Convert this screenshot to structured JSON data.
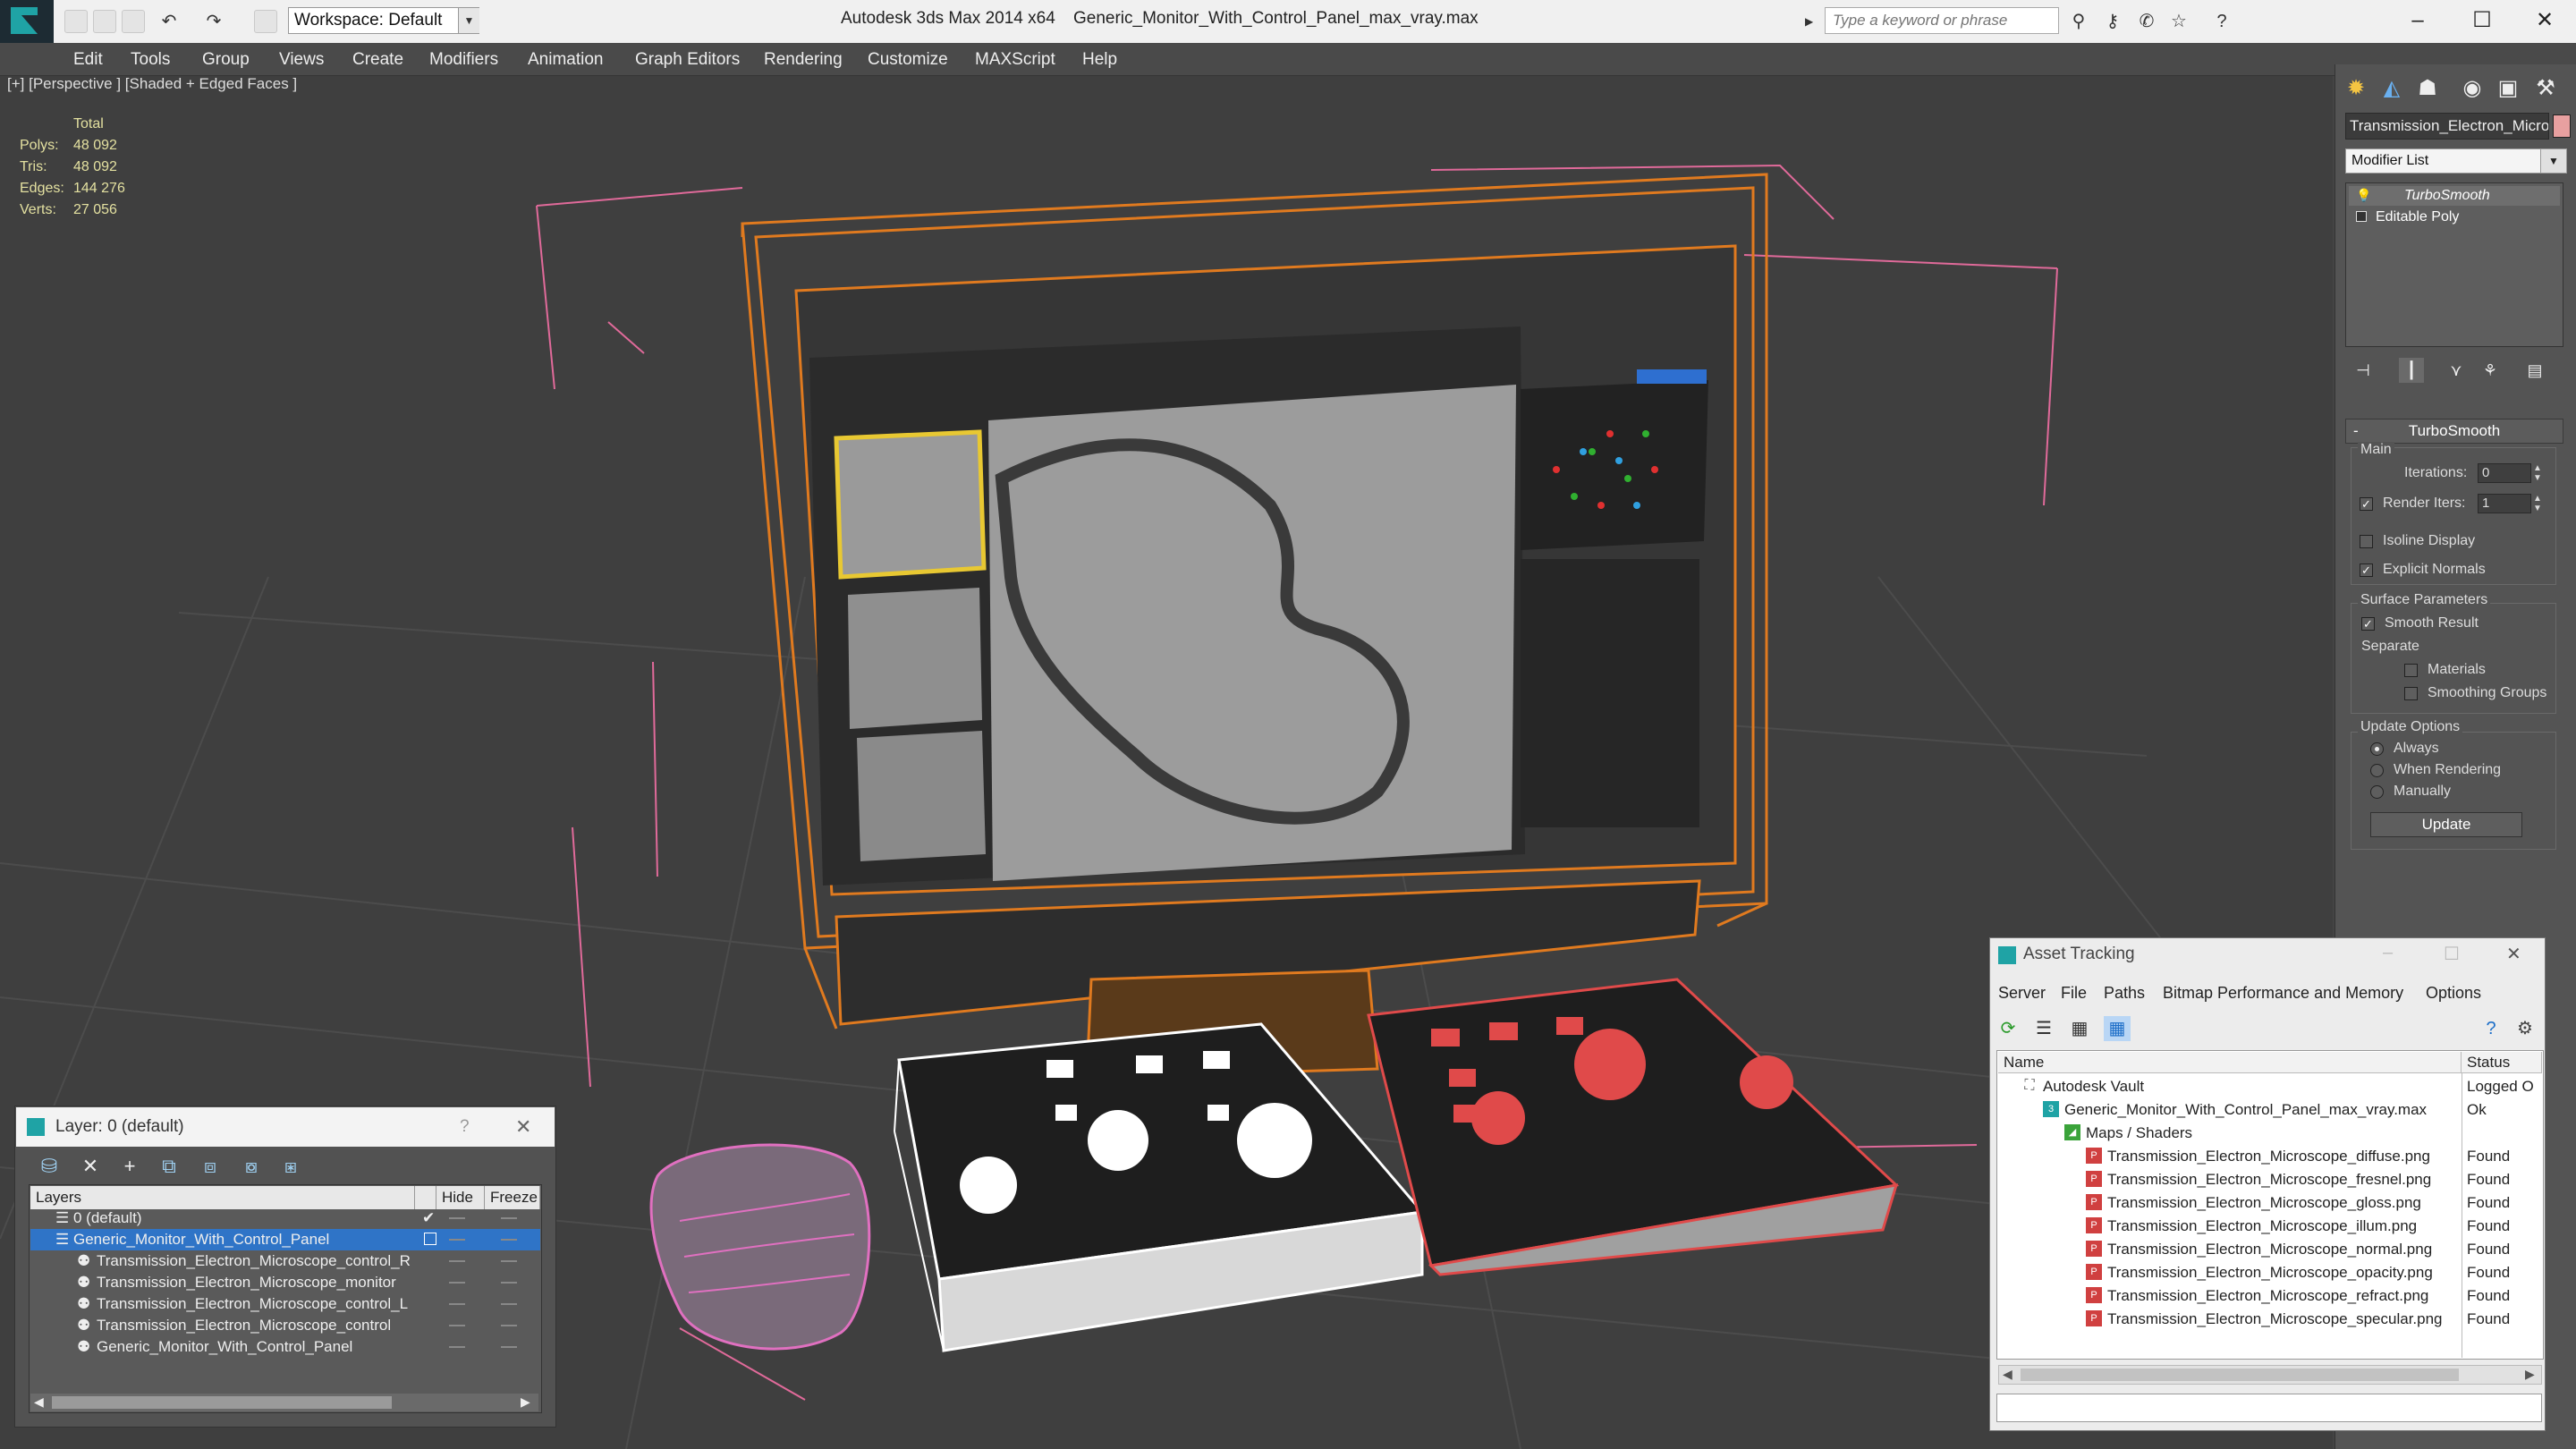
{
  "titlebar": {
    "workspace": "Workspace: Default",
    "app_title": "Autodesk 3ds Max  2014 x64",
    "file_title": "Generic_Monitor_With_Control_Panel_max_vray.max",
    "search_placeholder": "Type a keyword or phrase"
  },
  "menu": [
    "Edit",
    "Tools",
    "Group",
    "Views",
    "Create",
    "Modifiers",
    "Animation",
    "Graph Editors",
    "Rendering",
    "Customize",
    "MAXScript",
    "Help"
  ],
  "viewport": {
    "label": "[+] [Perspective ] [Shaded + Edged Faces ]",
    "stats": {
      "header": "Total",
      "rows": [
        {
          "label": "Polys:",
          "value": "48 092"
        },
        {
          "label": "Tris:",
          "value": "48 092"
        },
        {
          "label": "Edges:",
          "value": "144 276"
        },
        {
          "label": "Verts:",
          "value": "27 056"
        }
      ]
    }
  },
  "command_panel": {
    "object_name": "Transmission_Electron_Micros",
    "modifier_list": "Modifier List",
    "stack": [
      "TurboSmooth",
      "Editable Poly"
    ],
    "turbosmooth": {
      "title": "TurboSmooth",
      "main": "Main",
      "iterations_label": "Iterations:",
      "iterations_value": "0",
      "render_iters_label": "Render Iters:",
      "render_iters_value": "1",
      "isoline": "Isoline Display",
      "explicit_normals": "Explicit Normals",
      "surface_params": "Surface Parameters",
      "smooth_result": "Smooth Result",
      "separate": "Separate",
      "materials": "Materials",
      "smoothing_groups": "Smoothing Groups",
      "update_options": "Update Options",
      "always": "Always",
      "when_rendering": "When Rendering",
      "manually": "Manually",
      "update_btn": "Update"
    }
  },
  "layer_dialog": {
    "title": "Layer: 0 (default)",
    "help": "?",
    "headers": [
      "Layers",
      "Hide",
      "Freeze"
    ],
    "rows": [
      {
        "name": "0 (default)",
        "indent": 0,
        "selected": false
      },
      {
        "name": "Generic_Monitor_With_Control_Panel",
        "indent": 0,
        "selected": true
      },
      {
        "name": "Transmission_Electron_Microscope_control_R",
        "indent": 1,
        "selected": false
      },
      {
        "name": "Transmission_Electron_Microscope_monitor",
        "indent": 1,
        "selected": false
      },
      {
        "name": "Transmission_Electron_Microscope_control_L",
        "indent": 1,
        "selected": false
      },
      {
        "name": "Transmission_Electron_Microscope_control",
        "indent": 1,
        "selected": false
      },
      {
        "name": "Generic_Monitor_With_Control_Panel",
        "indent": 1,
        "selected": false
      }
    ]
  },
  "asset_tracking": {
    "title": "Asset Tracking",
    "menu": [
      "Server",
      "File",
      "Paths",
      "Bitmap Performance and Memory",
      "Options"
    ],
    "headers": [
      "Name",
      "Status"
    ],
    "rows": [
      {
        "name": "Autodesk Vault",
        "status": "Logged O",
        "indent": 0,
        "icon": "vault"
      },
      {
        "name": "Generic_Monitor_With_Control_Panel_max_vray.max",
        "status": "Ok",
        "indent": 1,
        "icon": "max"
      },
      {
        "name": "Maps / Shaders",
        "status": "",
        "indent": 2,
        "icon": "maps"
      },
      {
        "name": "Transmission_Electron_Microscope_diffuse.png",
        "status": "Found",
        "indent": 3,
        "icon": "png"
      },
      {
        "name": "Transmission_Electron_Microscope_fresnel.png",
        "status": "Found",
        "indent": 3,
        "icon": "png"
      },
      {
        "name": "Transmission_Electron_Microscope_gloss.png",
        "status": "Found",
        "indent": 3,
        "icon": "png"
      },
      {
        "name": "Transmission_Electron_Microscope_illum.png",
        "status": "Found",
        "indent": 3,
        "icon": "png"
      },
      {
        "name": "Transmission_Electron_Microscope_normal.png",
        "status": "Found",
        "indent": 3,
        "icon": "png"
      },
      {
        "name": "Transmission_Electron_Microscope_opacity.png",
        "status": "Found",
        "indent": 3,
        "icon": "png"
      },
      {
        "name": "Transmission_Electron_Microscope_refract.png",
        "status": "Found",
        "indent": 3,
        "icon": "png"
      },
      {
        "name": "Transmission_Electron_Microscope_specular.png",
        "status": "Found",
        "indent": 3,
        "icon": "png"
      }
    ]
  },
  "colors": {
    "accent": "#2f74c7",
    "stats": "#e3e0a0",
    "wire_orange": "#e07a1f",
    "wire_pink": "#e06a9a",
    "wire_red": "#e04a4a"
  }
}
